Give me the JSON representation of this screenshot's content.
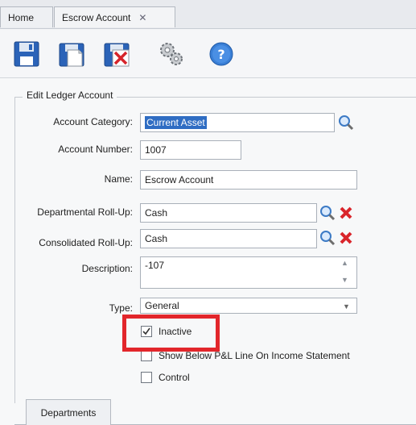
{
  "tabs": [
    {
      "label": "Home"
    },
    {
      "label": "Escrow Account"
    }
  ],
  "toolbar": {
    "buttons": [
      {
        "icon": "save-icon"
      },
      {
        "icon": "save-new-icon"
      },
      {
        "icon": "save-close-icon"
      },
      {
        "icon": "gears-icon"
      },
      {
        "icon": "help-icon"
      }
    ]
  },
  "form": {
    "group_title": "Edit Ledger Account",
    "account_category": {
      "label": "Account Category:",
      "value": "Current Asset"
    },
    "account_number": {
      "label": "Account Number:",
      "value": "1007"
    },
    "name": {
      "label": "Name:",
      "value": "Escrow Account"
    },
    "departmental_rollup": {
      "label": "Departmental Roll-Up:",
      "value": "Cash"
    },
    "consolidated_rollup": {
      "label": "Consolidated Roll-Up:",
      "value": "Cash"
    },
    "description": {
      "label": "Description:",
      "value": "-107"
    },
    "type": {
      "label": "Type:",
      "value": "General"
    },
    "checkboxes": [
      {
        "label": "Inactive",
        "checked": true
      },
      {
        "label": "Show Below P&L Line On Income Statement",
        "checked": false
      },
      {
        "label": "Control",
        "checked": false
      }
    ]
  },
  "bottom_tab": {
    "label": "Departments"
  },
  "colors": {
    "highlight": "#e2262b",
    "selection": "#2f6dc3"
  }
}
